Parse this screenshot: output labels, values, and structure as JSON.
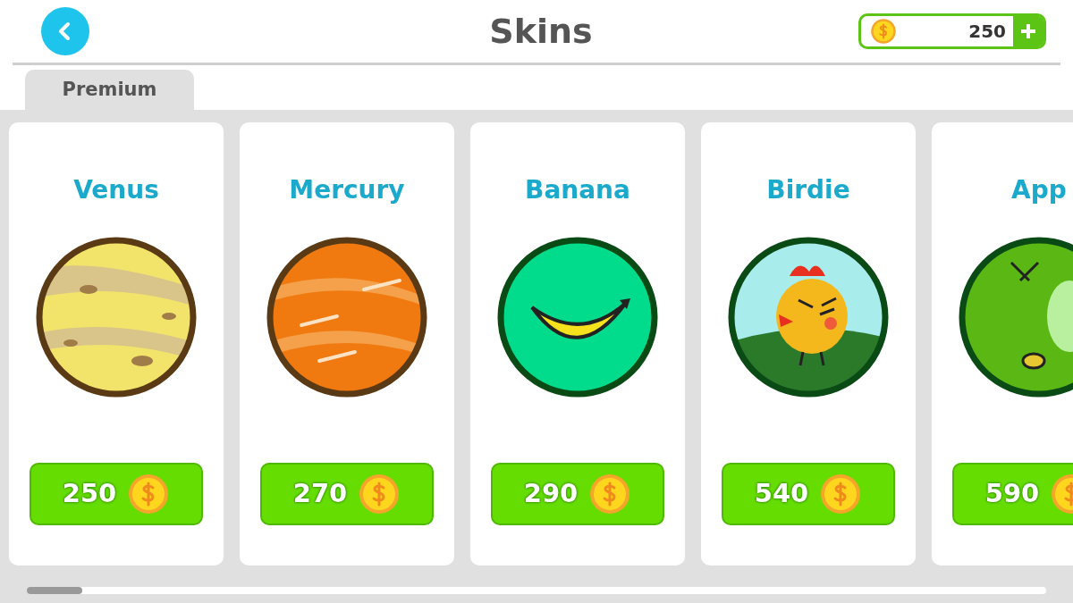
{
  "header": {
    "title": "Skins",
    "balance": "250"
  },
  "tabs": [
    {
      "label": "Premium",
      "selected": true
    }
  ],
  "skins": [
    {
      "name": "Venus",
      "kind": "venus",
      "price": "250"
    },
    {
      "name": "Mercury",
      "kind": "mercury",
      "price": "270"
    },
    {
      "name": "Banana",
      "kind": "banana",
      "price": "290"
    },
    {
      "name": "Birdie",
      "kind": "birdie",
      "price": "540"
    },
    {
      "name": "App",
      "kind": "apple",
      "price": "590"
    }
  ]
}
